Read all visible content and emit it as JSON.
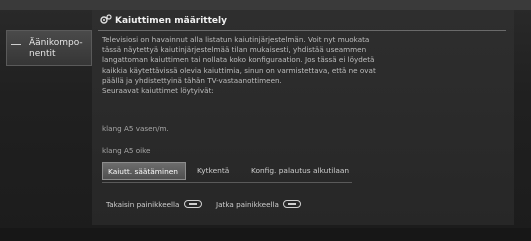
{
  "side_menu": {
    "label": "Äänikompo-\nnentit"
  },
  "dialog": {
    "title": "Kaiuttimen määrittely",
    "body_lines": [
      "Televisiosi on havainnut alla listatun kaiutinjärjestelmän. Voit nyt muokata",
      "tässä näytettyä kaiutinjärjestelmää tilan mukaisesti, yhdistää useammen",
      "langattoman kaiuttimen tai nollata koko konfiguraation. Jos tässä ei löydetä",
      "kaikkia käytettävissä olevia kaiuttimia, sinun on varmistettava, että ne ovat",
      "päällä ja yhdistettyinä tähän TV-vastaanottimeen.",
      "Seuraavat kaiuttimet löytyivät:"
    ],
    "speakers": [
      "klang A5 vasen/m.",
      "klang A5 oike"
    ],
    "tabs": [
      "Kaiutt. säätäminen",
      "Kytkentä",
      "Konfig. palautus alkutilaan"
    ],
    "selected_tab": 0,
    "hints": {
      "back": "Takaisin painikkeella",
      "next": "Jatka painikkeella"
    }
  },
  "colors": {
    "selected_tab": "#5c5c5c",
    "text": "#bdbdbd"
  },
  "icons": {
    "title": "gears-icon",
    "key": "ok-key-icon"
  }
}
